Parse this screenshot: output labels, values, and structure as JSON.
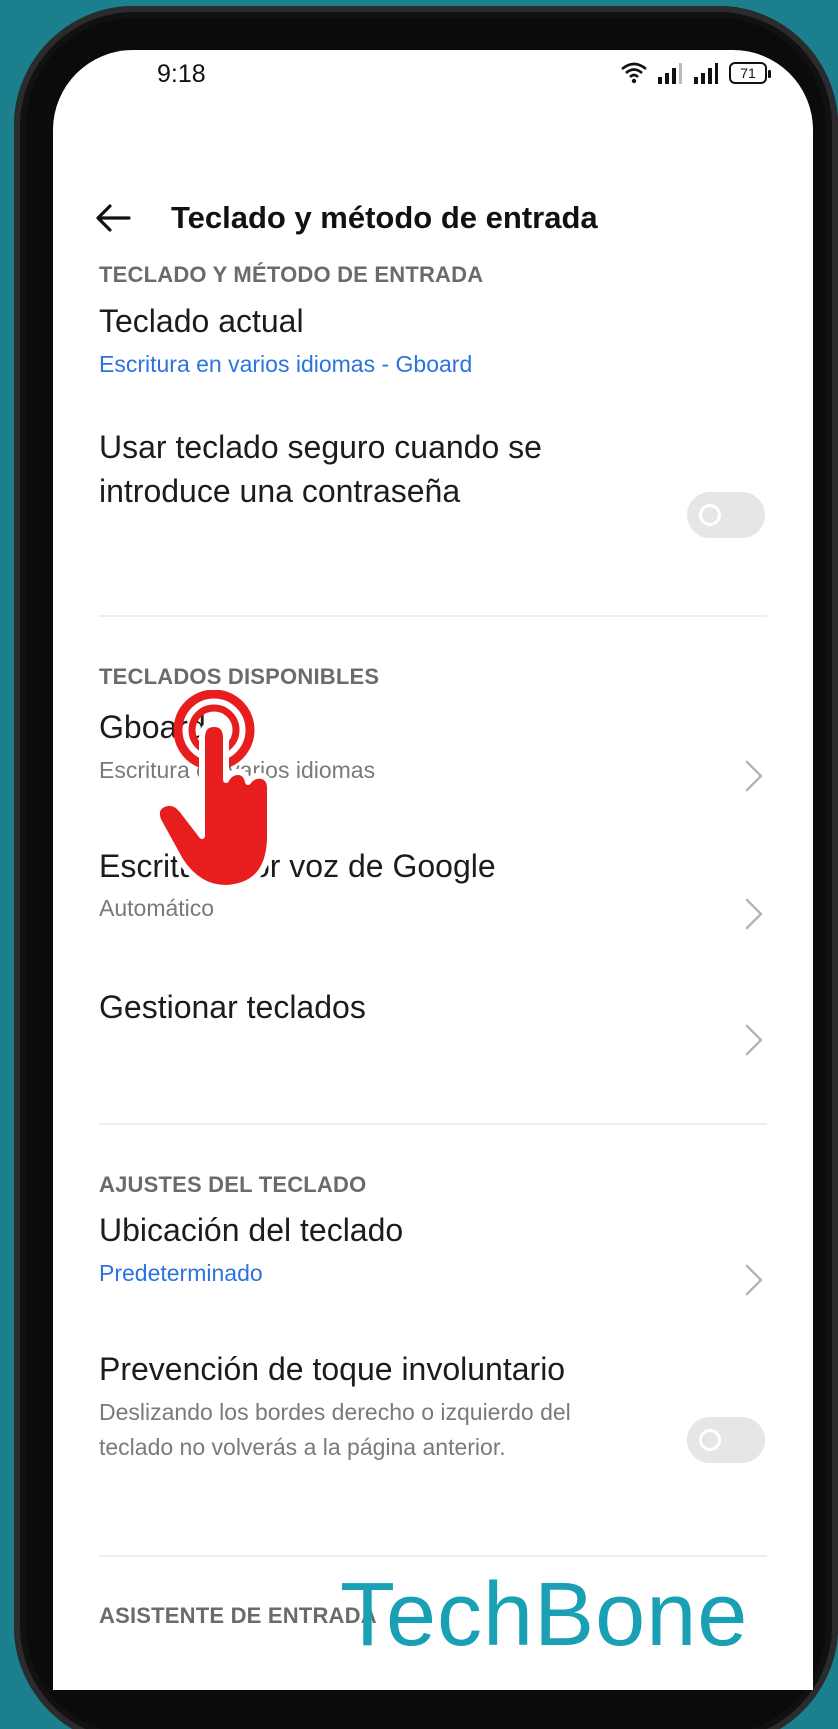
{
  "status_bar": {
    "time": "9:18",
    "battery": "71"
  },
  "header": {
    "title": "Teclado y método de entrada"
  },
  "sections": {
    "input_method": {
      "header": "TECLADO Y MÉTODO DE ENTRADA",
      "current_keyboard": {
        "title": "Teclado actual",
        "subtitle": "Escritura en varios idiomas - Gboard"
      },
      "secure_keyboard": {
        "title_line1": "Usar teclado seguro cuando se",
        "title_line2": "introduce una contraseña",
        "enabled": false
      }
    },
    "available": {
      "header": "TECLADOS DISPONIBLES",
      "gboard": {
        "title": "Gboard",
        "subtitle": "Escritura en varios idiomas"
      },
      "voice": {
        "title": "Escritura por voz de Google",
        "subtitle": "Automático"
      },
      "manage": {
        "title": "Gestionar teclados"
      }
    },
    "settings": {
      "header": "AJUSTES DEL TECLADO",
      "location": {
        "title": "Ubicación del teclado",
        "subtitle": "Predeterminado"
      },
      "prevention": {
        "title": "Prevención de toque involuntario",
        "subtitle_line1": "Deslizando los bordes derecho o izquierdo del",
        "subtitle_line2": "teclado no volverás a la página anterior.",
        "enabled": false
      }
    },
    "assistant": {
      "header": "ASISTENTE DE ENTRADA"
    }
  },
  "watermark": "TechBone",
  "colors": {
    "accent": "#2b73e0",
    "background": "#1b7f8e",
    "tap_indicator": "#e81e1e"
  }
}
